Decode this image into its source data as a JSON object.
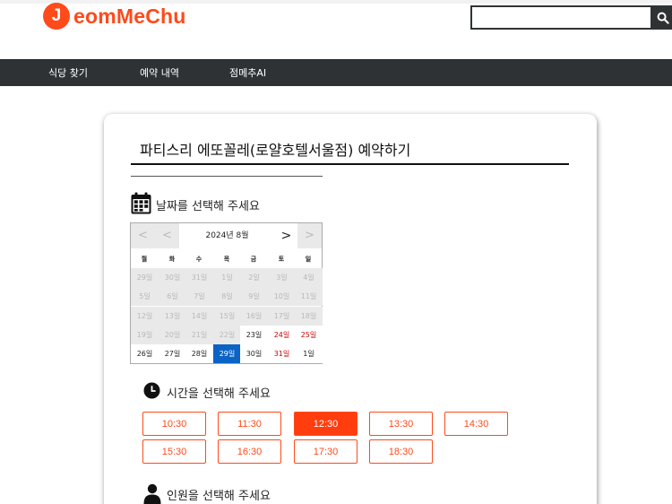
{
  "header": {
    "logo_letter": "J",
    "logo_text": "eomMeChu",
    "search_placeholder": "",
    "brand_color": "#ff4a1a"
  },
  "nav": {
    "items": [
      {
        "label": "식당 찾기"
      },
      {
        "label": "예약 내역"
      },
      {
        "label": "점메추AI"
      }
    ]
  },
  "page": {
    "title": "파티스리 에또꼴레(로얄호텔서울점) 예약하기",
    "date_label": "날짜를 선택해 주세요",
    "time_label": "시간을 선택해 주세요",
    "people_label": "인원을 선택해 주세요"
  },
  "calendar": {
    "month_label": "2024년 8월",
    "prev_year": "<",
    "prev_month": "<",
    "next_month": ">",
    "next_year": ">",
    "weekdays": [
      "월",
      "화",
      "수",
      "목",
      "금",
      "토",
      "일"
    ],
    "weeks": [
      [
        {
          "d": "29일",
          "s": "dis"
        },
        {
          "d": "30일",
          "s": "dis"
        },
        {
          "d": "31일",
          "s": "dis"
        },
        {
          "d": "1일",
          "s": "dis"
        },
        {
          "d": "2일",
          "s": "dis"
        },
        {
          "d": "3일",
          "s": "dis"
        },
        {
          "d": "4일",
          "s": "dis"
        }
      ],
      [
        {
          "d": "5일",
          "s": "dis"
        },
        {
          "d": "6일",
          "s": "dis"
        },
        {
          "d": "7일",
          "s": "dis"
        },
        {
          "d": "8일",
          "s": "dis"
        },
        {
          "d": "9일",
          "s": "dis"
        },
        {
          "d": "10일",
          "s": "dis"
        },
        {
          "d": "11일",
          "s": "dis"
        }
      ],
      [
        {
          "d": "12일",
          "s": "dis"
        },
        {
          "d": "13일",
          "s": "dis"
        },
        {
          "d": "14일",
          "s": "dis"
        },
        {
          "d": "15일",
          "s": "dis"
        },
        {
          "d": "16일",
          "s": "dis"
        },
        {
          "d": "17일",
          "s": "dis"
        },
        {
          "d": "18일",
          "s": "dis"
        }
      ],
      [
        {
          "d": "19일",
          "s": "dis"
        },
        {
          "d": "20일",
          "s": "dis"
        },
        {
          "d": "21일",
          "s": "dis"
        },
        {
          "d": "22일",
          "s": "dis"
        },
        {
          "d": "23일",
          "s": "en"
        },
        {
          "d": "24일",
          "s": "wk"
        },
        {
          "d": "25일",
          "s": "wk"
        }
      ],
      [
        {
          "d": "26일",
          "s": "en"
        },
        {
          "d": "27일",
          "s": "en"
        },
        {
          "d": "28일",
          "s": "en"
        },
        {
          "d": "29일",
          "s": "sel"
        },
        {
          "d": "30일",
          "s": "en"
        },
        {
          "d": "31일",
          "s": "wk"
        },
        {
          "d": "1일",
          "s": "en"
        }
      ]
    ],
    "selected_color": "#0b63c6"
  },
  "times": {
    "slots": [
      {
        "label": "10:30",
        "active": false
      },
      {
        "label": "11:30",
        "active": false
      },
      {
        "label": "12:30",
        "active": true
      },
      {
        "label": "13:30",
        "active": false
      },
      {
        "label": "14:30",
        "active": false
      },
      {
        "label": "15:30",
        "active": false
      },
      {
        "label": "16:30",
        "active": false
      },
      {
        "label": "17:30",
        "active": false
      },
      {
        "label": "18:30",
        "active": false
      }
    ]
  }
}
